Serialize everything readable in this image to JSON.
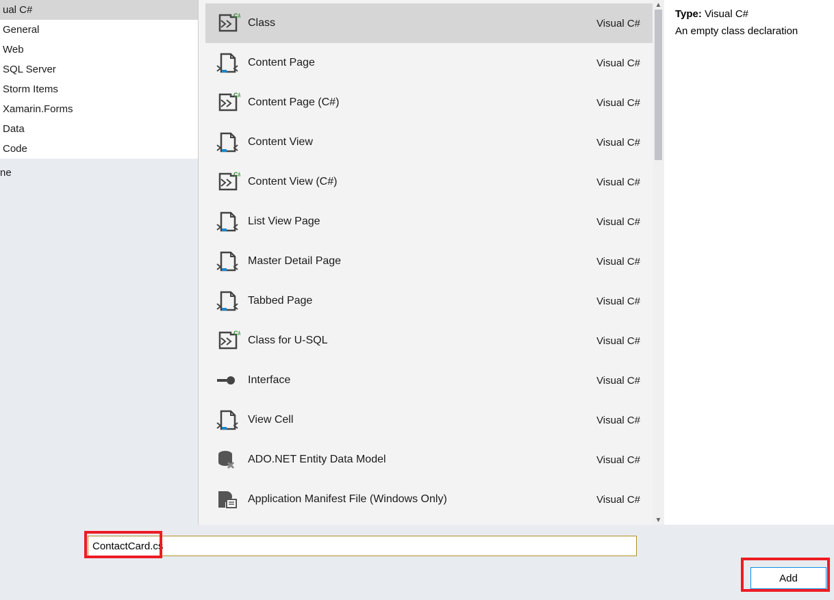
{
  "sidebar": {
    "items": [
      {
        "label": "ual C#"
      },
      {
        "label": "General"
      },
      {
        "label": "Web"
      },
      {
        "label": "SQL Server"
      },
      {
        "label": "Storm Items"
      },
      {
        "label": "Xamarin.Forms"
      },
      {
        "label": "Data"
      },
      {
        "label": "Code"
      }
    ],
    "below_label": "ne"
  },
  "templates": {
    "lang": "Visual C#",
    "items": [
      {
        "name": "Class",
        "icon": "class"
      },
      {
        "name": "Content Page",
        "icon": "page"
      },
      {
        "name": "Content Page (C#)",
        "icon": "class"
      },
      {
        "name": "Content View",
        "icon": "page"
      },
      {
        "name": "Content View (C#)",
        "icon": "class"
      },
      {
        "name": "List View Page",
        "icon": "page"
      },
      {
        "name": "Master Detail Page",
        "icon": "page"
      },
      {
        "name": "Tabbed Page",
        "icon": "page"
      },
      {
        "name": "Class for U-SQL",
        "icon": "class"
      },
      {
        "name": "Interface",
        "icon": "interface"
      },
      {
        "name": "View Cell",
        "icon": "page"
      },
      {
        "name": "ADO.NET Entity Data Model",
        "icon": "entity"
      },
      {
        "name": "Application Manifest File (Windows Only)",
        "icon": "manifest"
      }
    ]
  },
  "details": {
    "type_label": "Type:",
    "type_value": "Visual C#",
    "description": "An empty class declaration"
  },
  "bottom": {
    "name_value": "ContactCard.cs",
    "add_label": "Add"
  }
}
